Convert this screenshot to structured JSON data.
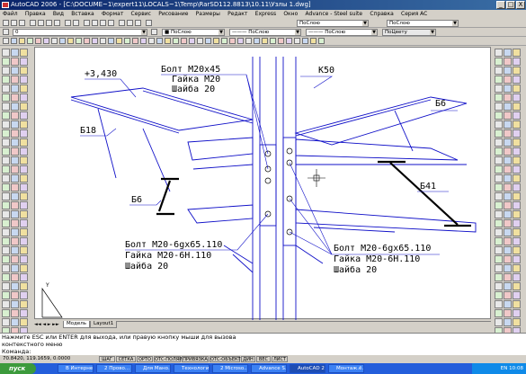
{
  "window": {
    "title": "AutoCAD 2006 - [C:\\DOCUME~1\\expert11\\LOCALS~1\\Temp\\RarSD112.8813\\10.11\\Узлы 1.dwg]",
    "buttons": [
      "_",
      "□",
      "X"
    ]
  },
  "menu": [
    "Файл",
    "Правка",
    "Вид",
    "Вставка",
    "Формат",
    "Сервис",
    "Рисование",
    "Размеры",
    "Редакт",
    "Express",
    "Окно",
    "Advance - Steel suite",
    "Справка",
    "Серия AC"
  ],
  "toolbar": {
    "layer_combo": "0",
    "color_combo": "■ ПоСлою",
    "linetype_combo": "——— ПоСлою",
    "lineweight_combo": "——— ПоСлою",
    "plotstyle_combo": "ПоЦвету",
    "style_combo1": "ПоСлою",
    "style_combo2": "ПоСлою"
  },
  "drawing": {
    "labels": {
      "elevation": "+3,430",
      "b18": "Б18",
      "b6_left": "Б6",
      "b6_right": "Б6",
      "b41": "Б41",
      "k50": "К50",
      "bolt_top": "Болт М20х45",
      "nut_top": "Гайка М20",
      "washer_top": "Шайба 20",
      "bolt_bl": "Болт М20-6gх65.110",
      "nut_bl": "Гайка М20-6Н.110",
      "washer_bl": "Шайба 20",
      "bolt_br": "Болт М20-6gх65.110",
      "nut_br": "Гайка М20-6Н.110",
      "washer_br": "Шайба 20"
    },
    "ucs": "Y",
    "colors": {
      "line": "#1010c8",
      "bg": "#ffffff"
    }
  },
  "tabs": [
    "Модель",
    "Layout1"
  ],
  "command": {
    "line1": "Нажмите ESC или ENTER для выхода, или правую кнопку мыши для вызова",
    "line2": "контекстного меню",
    "prompt": "Команда:"
  },
  "status": {
    "coords": "70.8420, 119.1659, 0.0000",
    "buttons": [
      "ШАГ",
      "СЕТКА",
      "ОРТО",
      "ОТС-ПОЛЯР",
      "ПРИВЯЗКА",
      "ОТС-ОБЪЕКТ",
      "ДИН",
      "ВЕС",
      "ЛИСТ"
    ]
  },
  "taskbar": {
    "start": "пуск",
    "tasks": [
      "В Интерне...",
      "2 Прово...",
      "Для Мано...",
      "Технологи...",
      "2 Microso...",
      "Advance S...",
      "AutoCAD 2...",
      "Монтаж.ё..."
    ],
    "lang": "EN",
    "time": "10:08"
  }
}
